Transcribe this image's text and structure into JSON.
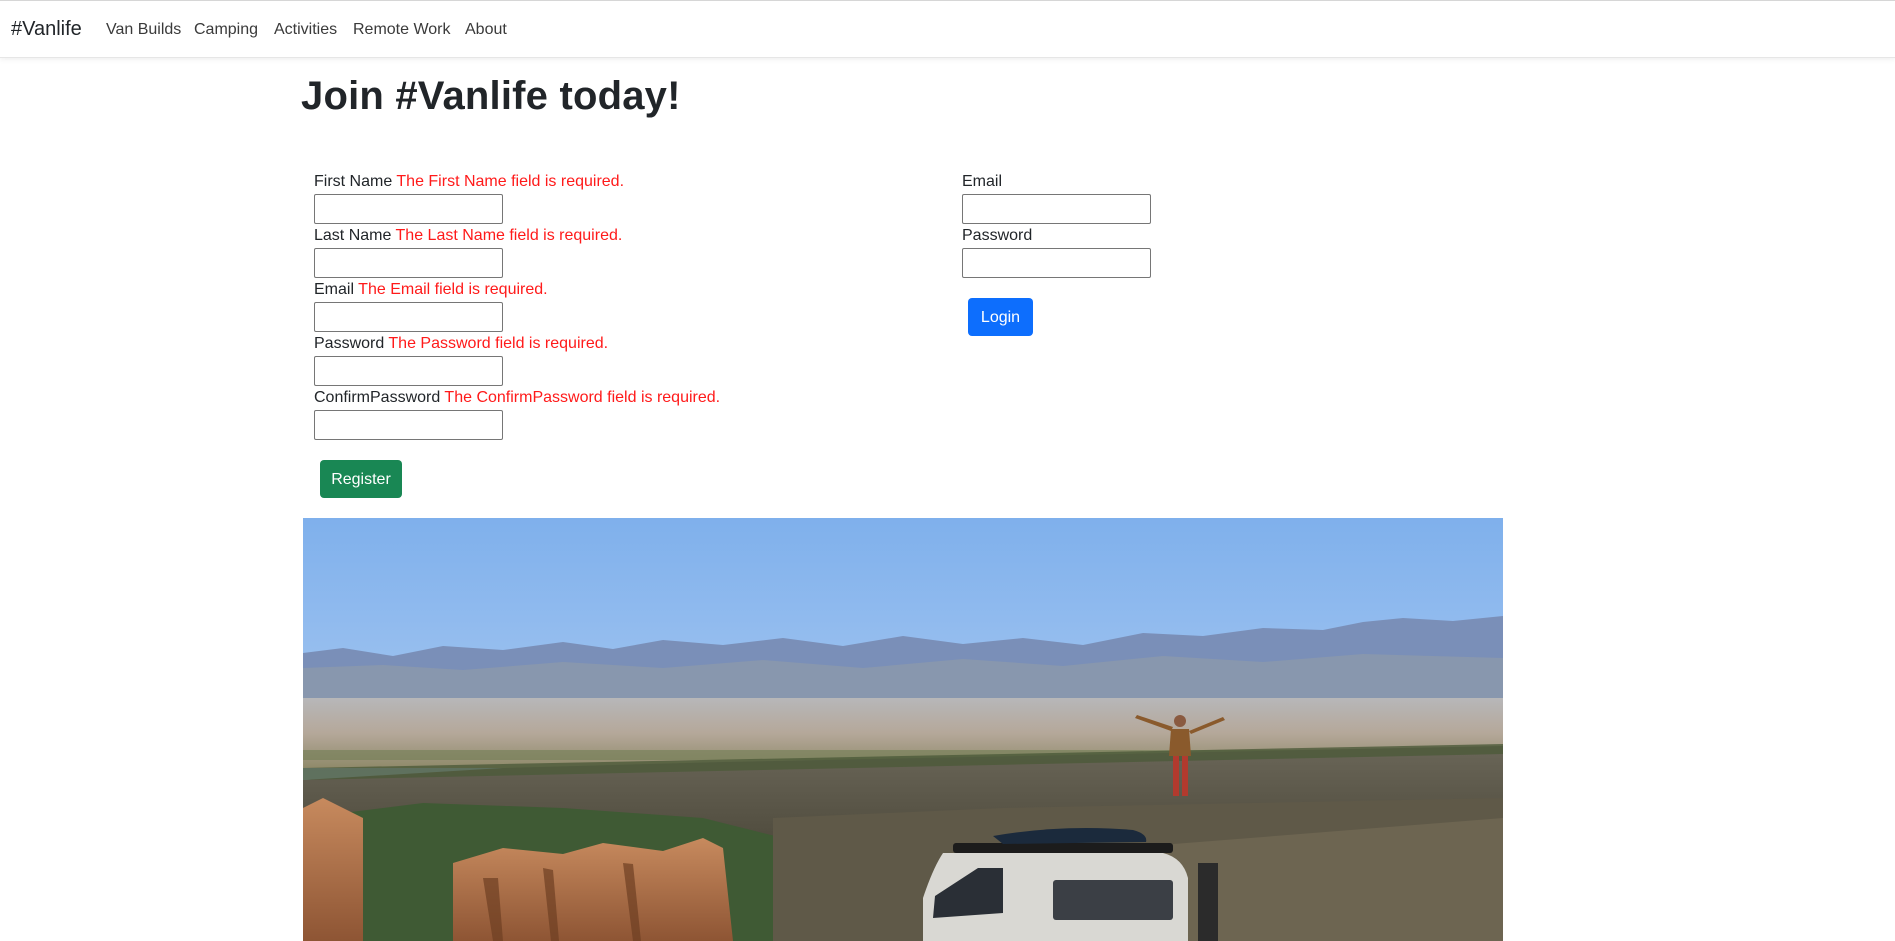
{
  "navbar": {
    "brand": "#Vanlife",
    "links": [
      "Van Builds",
      "Camping",
      "Activities",
      "Remote Work",
      "About"
    ]
  },
  "page": {
    "title": "Join #Vanlife today!"
  },
  "register": {
    "fields": [
      {
        "label": "First Name",
        "error": "The First Name field is required.",
        "value": ""
      },
      {
        "label": "Last Name",
        "error": "The Last Name field is required.",
        "value": ""
      },
      {
        "label": "Email",
        "error": "The Email field is required.",
        "value": ""
      },
      {
        "label": "Password",
        "error": "The Password field is required.",
        "value": ""
      },
      {
        "label": "ConfirmPassword",
        "error": "The ConfirmPassword field is required.",
        "value": ""
      }
    ],
    "button": "Register"
  },
  "login": {
    "fields": [
      {
        "label": "Email",
        "value": ""
      },
      {
        "label": "Password",
        "value": ""
      }
    ],
    "button": "Login"
  },
  "colors": {
    "error": "#ff1a1a",
    "register_button": "#198754",
    "login_button": "#0d6efd"
  }
}
